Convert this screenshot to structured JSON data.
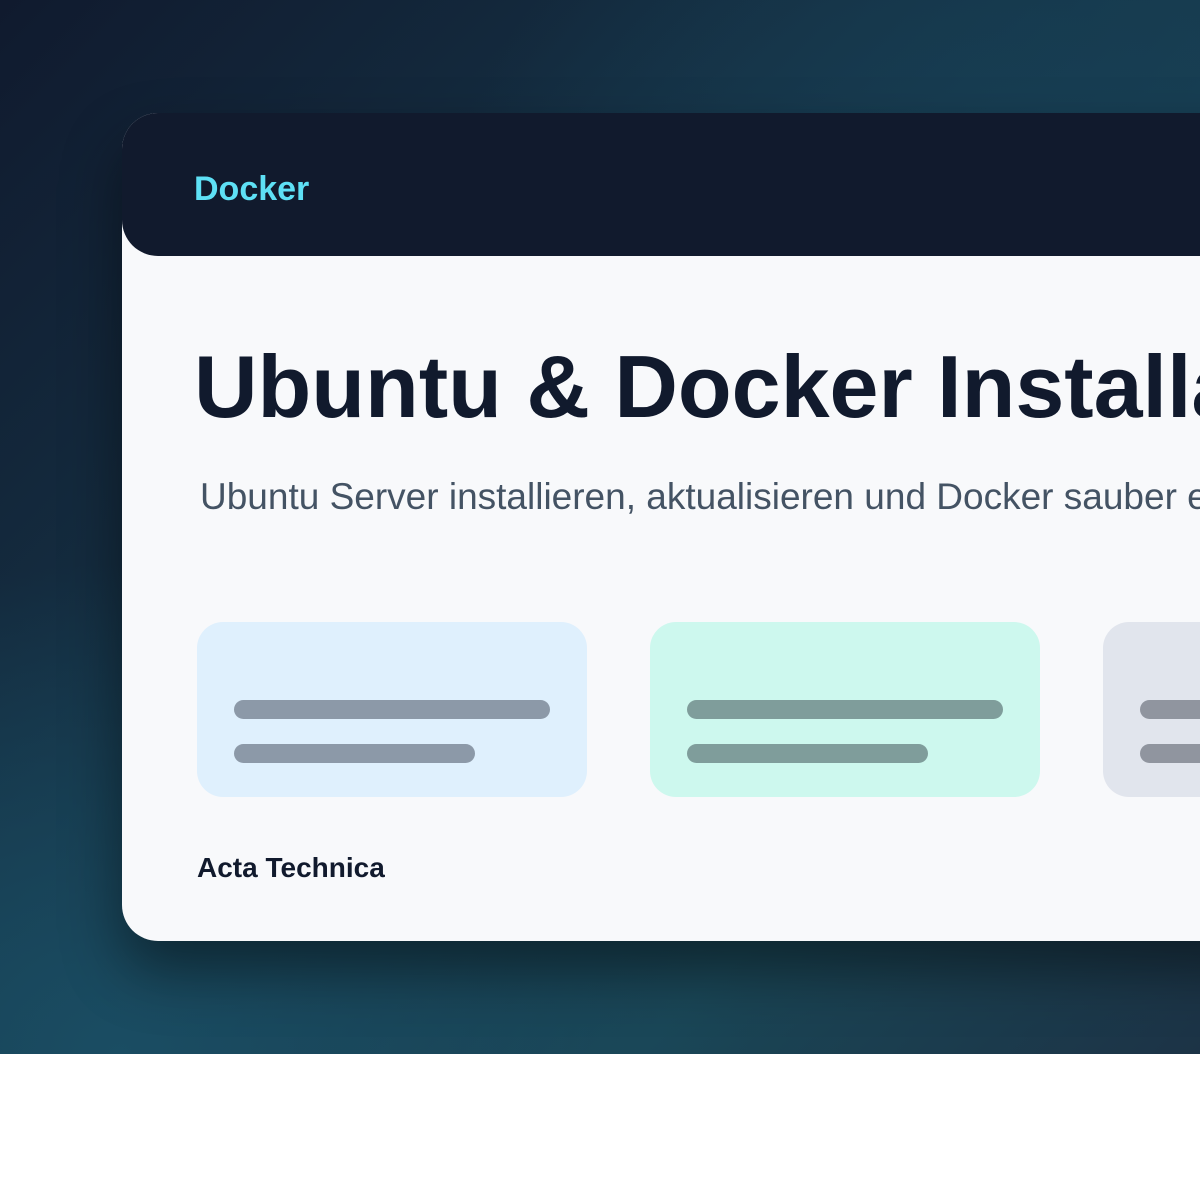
{
  "header": {
    "brand": "Docker"
  },
  "main": {
    "title": "Ubuntu & Docker Installation",
    "subtitle": "Ubuntu Server installieren, aktualisieren und Docker sauber einrichten"
  },
  "tiles": [
    {
      "color": "#dff0fd",
      "bar_color": "#8c99a8"
    },
    {
      "color": "#cdf8ee",
      "bar_color": "#7f9d9b"
    },
    {
      "color": "#e1e5ed",
      "bar_color": "#90959f"
    }
  ],
  "footer": {
    "label": "Acta Technica"
  },
  "colors": {
    "accent": "#5ee0f5",
    "header_bg": "#111a2d",
    "card_bg": "#f8f9fb",
    "title": "#111a2d",
    "subtitle": "#445364"
  }
}
